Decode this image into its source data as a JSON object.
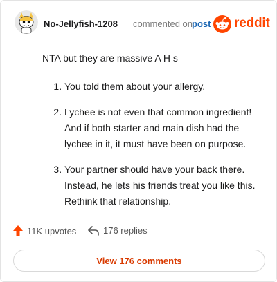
{
  "comment": {
    "username": "No-Jellyfish-1208",
    "action_text": "commented on",
    "post_link": "post",
    "brand": "reddit",
    "intro": "NTA but they are massive A H s",
    "points": [
      "You told them about your allergy.",
      "Lychee is not even that common ingredient! And if both starter and main dish had the lychee in it, it must have been on purpose.",
      "Your partner should have your back there. Instead, he lets his friends treat you like this. Rethink that relationship."
    ]
  },
  "stats": {
    "upvotes": "11K upvotes",
    "replies": "176 replies"
  },
  "view_button": "View 176 comments",
  "colors": {
    "brand_orange": "#ff4500",
    "link_blue": "#1a66b3",
    "button_text": "#d93a00"
  },
  "icons": [
    "avatar-snoo-icon",
    "reddit-logo-icon",
    "upvote-arrow-icon",
    "reply-arrow-icon"
  ]
}
